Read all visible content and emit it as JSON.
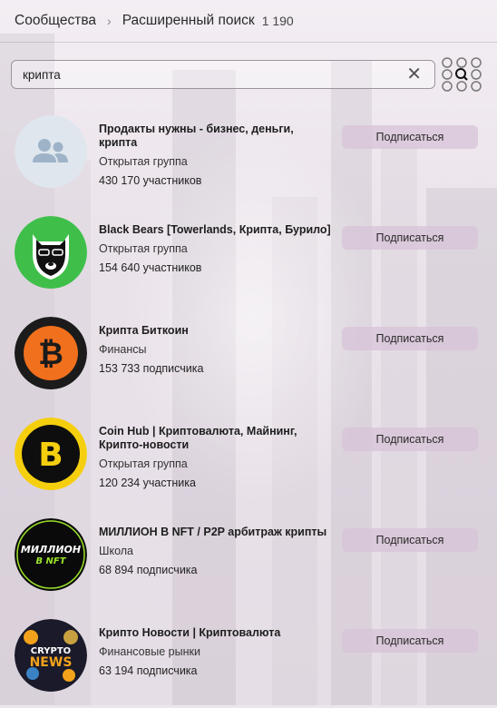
{
  "header": {
    "crumb_communities": "Сообщества",
    "crumb_advanced_search": "Расширенный поиск",
    "result_count": "1 190"
  },
  "search": {
    "query": "крипта"
  },
  "results": [
    {
      "title": "Продакты нужны - бизнес, деньги, крипта",
      "type": "Открытая группа",
      "members": "430 170 участников",
      "button": "Подписаться"
    },
    {
      "title": "Black Bears [Towerlands, Крипта, Бурило]",
      "type": "Открытая группа",
      "members": "154 640 участников",
      "button": "Подписаться"
    },
    {
      "title": "Крипта Биткоин",
      "type": "Финансы",
      "members": "153 733 подписчика",
      "button": "Подписаться"
    },
    {
      "title": "Coin Hub | Криптовалюта, Майнинг, Крипто-новости",
      "type": "Открытая группа",
      "members": "120 234 участника",
      "button": "Подписаться"
    },
    {
      "title": "МИЛЛИОН В NFT / P2P арбитраж крипты",
      "type": "Школа",
      "members": "68 894 подписчика",
      "button": "Подписаться"
    },
    {
      "title": "Крипто Новости | Криптовалюта",
      "type": "Финансовые рынки",
      "members": "63 194 подписчика",
      "button": "Подписаться"
    }
  ],
  "avatars": {
    "a5_line1": "МИЛЛИОН",
    "a5_line2": "В NFT",
    "a6_line1": "CRYPTO",
    "a6_line2": "NEWS"
  },
  "colors": {
    "bitcoin_orange": "#f0701d",
    "coinhub_yellow": "#f5cf0e",
    "bear_green": "#3fbf4a",
    "nft_green": "#9be22a",
    "button_bg": "#dcc5dc"
  }
}
